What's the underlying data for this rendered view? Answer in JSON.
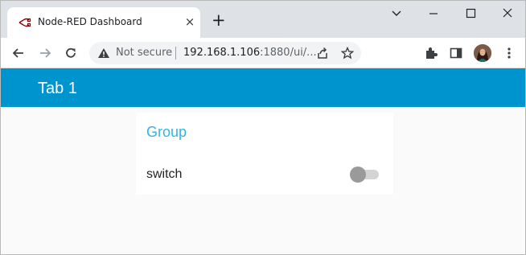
{
  "browser": {
    "tab": {
      "title": "Node-RED Dashboard",
      "favicon": "node-red-icon",
      "close": "×"
    },
    "new_tab": "+",
    "window_controls": [
      "minimize-icon",
      "maximize-icon",
      "close-icon"
    ],
    "security_label": "Not secure",
    "url_host": "192.168.1.106",
    "url_rest": ":1880/ui/..."
  },
  "dashboard": {
    "header_title": "Tab 1",
    "header_color": "#0094ce",
    "group": {
      "title": "Group",
      "title_color": "#33b4e6",
      "switch": {
        "label": "switch",
        "state": "off"
      }
    }
  }
}
